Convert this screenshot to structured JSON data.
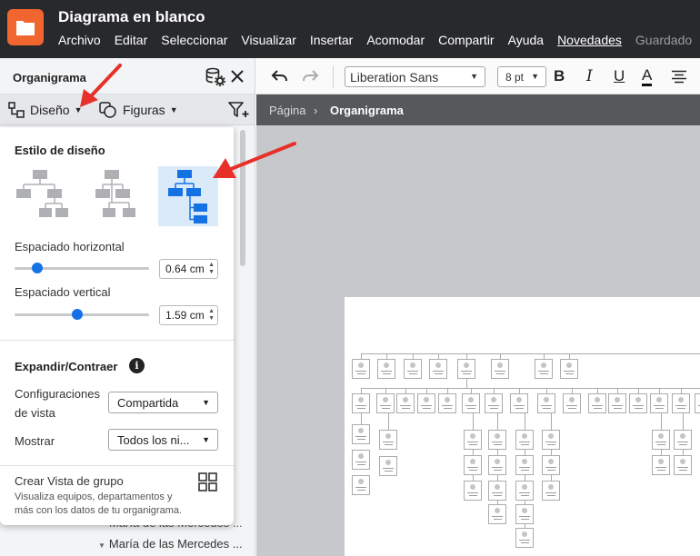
{
  "window": {
    "title": "Diagrama en blanco",
    "menu": [
      "Archivo",
      "Editar",
      "Seleccionar",
      "Visualizar",
      "Insertar",
      "Acomodar",
      "Compartir",
      "Ayuda",
      "Novedades",
      "Guardado"
    ]
  },
  "panel": {
    "title": "Organigrama",
    "tabs": {
      "design": "Diseño",
      "shapes": "Figuras"
    },
    "tree_items": [
      "María de las Mercedes ...",
      "María de las Mercedes ..."
    ]
  },
  "popover": {
    "layout_title": "Estilo de diseño",
    "layout_selected_index": 2,
    "h_spacing_label": "Espaciado horizontal",
    "h_spacing_value": "0.64 cm",
    "h_spacing_level": 0.14,
    "v_spacing_label": "Espaciado vertical",
    "v_spacing_value": "1.59 cm",
    "v_spacing_level": 0.46,
    "expand_title": "Expandir/Contraer",
    "view_config_label_1": "Configuraciones",
    "view_config_label_2": "de vista",
    "view_config_value": "Compartida",
    "show_label": "Mostrar",
    "show_value": "Todos los ni...",
    "group_view_title": "Crear Vista de grupo",
    "group_view_desc_1": "Visualiza equipos, departamentos y",
    "group_view_desc_2": "más con los datos de tu organigrama."
  },
  "toolbar": {
    "font": "Liberation Sans",
    "size": "8 pt",
    "bold": "B",
    "italic": "I",
    "underline": "U",
    "color": "A"
  },
  "breadcrumb": {
    "root": "Página",
    "separator": "›",
    "current": "Organigrama"
  },
  "colors": {
    "accent": "#1572e5",
    "brand": "#f0662e",
    "titlebar": "#28292c",
    "arrow": "#e8302a"
  }
}
